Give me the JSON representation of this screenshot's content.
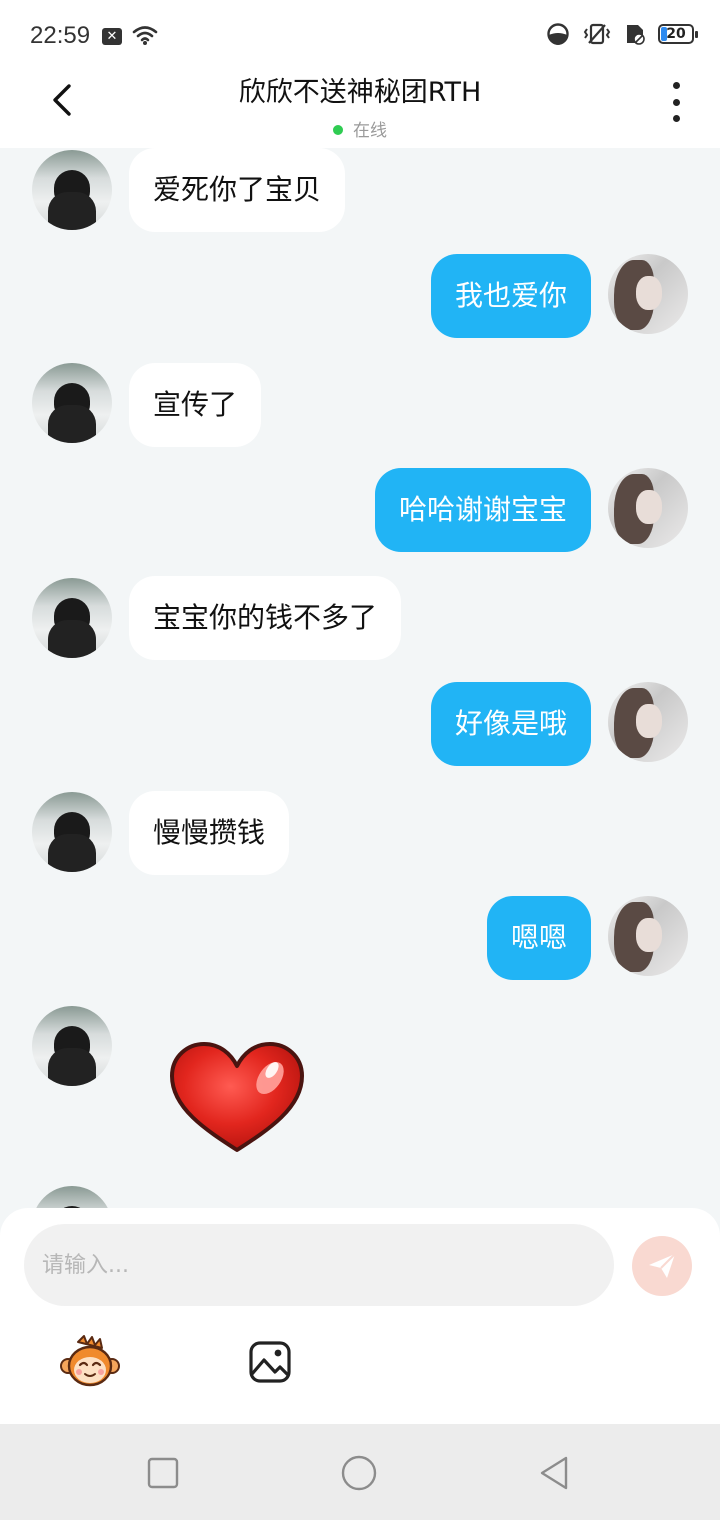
{
  "status": {
    "time": "22:59",
    "battery": "20",
    "icons": [
      "close-notification-icon",
      "wifi-icon",
      "data-saver-icon",
      "vibrate-icon",
      "sim-icon",
      "battery-icon"
    ]
  },
  "header": {
    "title": "欣欣不送神秘团RTH",
    "status_text": "在线",
    "status_color": "#2fcc52"
  },
  "messages": [
    {
      "from": "other",
      "text": "爱死你了宝贝"
    },
    {
      "from": "self",
      "text": "我也爱你"
    },
    {
      "from": "other",
      "text": "宣传了"
    },
    {
      "from": "self",
      "text": "哈哈谢谢宝宝"
    },
    {
      "from": "other",
      "text": "宝宝你的钱不多了"
    },
    {
      "from": "self",
      "text": "好像是哦"
    },
    {
      "from": "other",
      "text": "慢慢攒钱"
    },
    {
      "from": "self",
      "text": "嗯嗯"
    },
    {
      "from": "other",
      "sticker": "red-heart"
    }
  ],
  "composer": {
    "placeholder": "请输入...",
    "value": ""
  },
  "colors": {
    "self_bubble": "#21b4f5",
    "other_bubble": "#ffffff",
    "chat_background": "#f3f6f7",
    "send_button": "#f9d9d1"
  }
}
